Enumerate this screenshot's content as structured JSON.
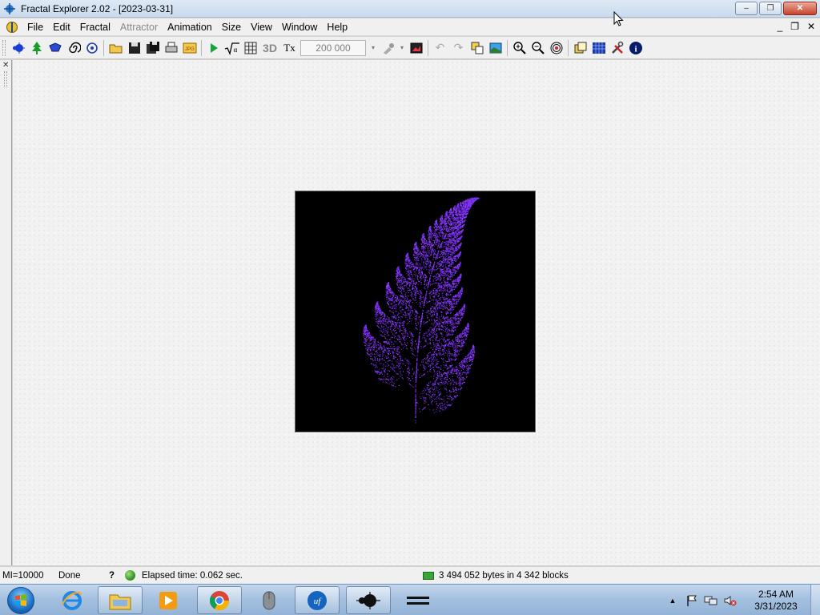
{
  "window": {
    "title": "Fractal Explorer 2.02  - [2023-03-31]",
    "minimize_symbol": "–",
    "restore_symbol": "❐",
    "close_symbol": "✕"
  },
  "menu": {
    "items": [
      {
        "label": "File",
        "enabled": true
      },
      {
        "label": "Edit",
        "enabled": true
      },
      {
        "label": "Fractal",
        "enabled": true
      },
      {
        "label": "Attractor",
        "enabled": false
      },
      {
        "label": "Animation",
        "enabled": true
      },
      {
        "label": "Size",
        "enabled": true
      },
      {
        "label": "View",
        "enabled": true
      },
      {
        "label": "Window",
        "enabled": true
      },
      {
        "label": "Help",
        "enabled": true
      }
    ],
    "mdi_controls": {
      "minimize": "_",
      "restore": "❐",
      "close": "✕"
    }
  },
  "toolbar": {
    "label_3d": "3D",
    "label_tx": "Tx",
    "iterations_value": "200 000",
    "icons": [
      "mandelbrot-icon",
      "fern-tree-icon",
      "ifs-icon",
      "spiral-icon",
      "target-icon",
      "open-icon",
      "save-icon",
      "save-all-icon",
      "print-icon",
      "jpg-icon",
      "play-icon",
      "sqrt-icon",
      "grid-icon",
      "brush-icon",
      "picture-icon",
      "undo-icon",
      "redo-icon",
      "copy-window-icon",
      "image-window-icon",
      "zoom-in-icon",
      "zoom-out-icon",
      "zoom-target-icon",
      "layers-icon",
      "palette-grid-icon",
      "tools-icon",
      "info-icon"
    ]
  },
  "canvas": {
    "background": "#000000",
    "fern_colors": [
      "#7b2ff7",
      "#9b45ff",
      "#5a1fc8"
    ]
  },
  "status": {
    "mi": "MI=10000",
    "state": "Done",
    "help": "?",
    "elapsed": "Elapsed time: 0.062 sec.",
    "memory": "3 494 052 bytes in 4 342 blocks"
  },
  "taskbar": {
    "apps": [
      "internet-explorer-icon",
      "file-explorer-icon",
      "media-player-icon",
      "chrome-icon",
      "mouse-icon",
      "ultra-fractal-icon",
      "fractal-explorer-icon",
      "menu-lines-icon"
    ],
    "clock_time": "2:54 AM",
    "clock_date": "3/31/2023"
  }
}
